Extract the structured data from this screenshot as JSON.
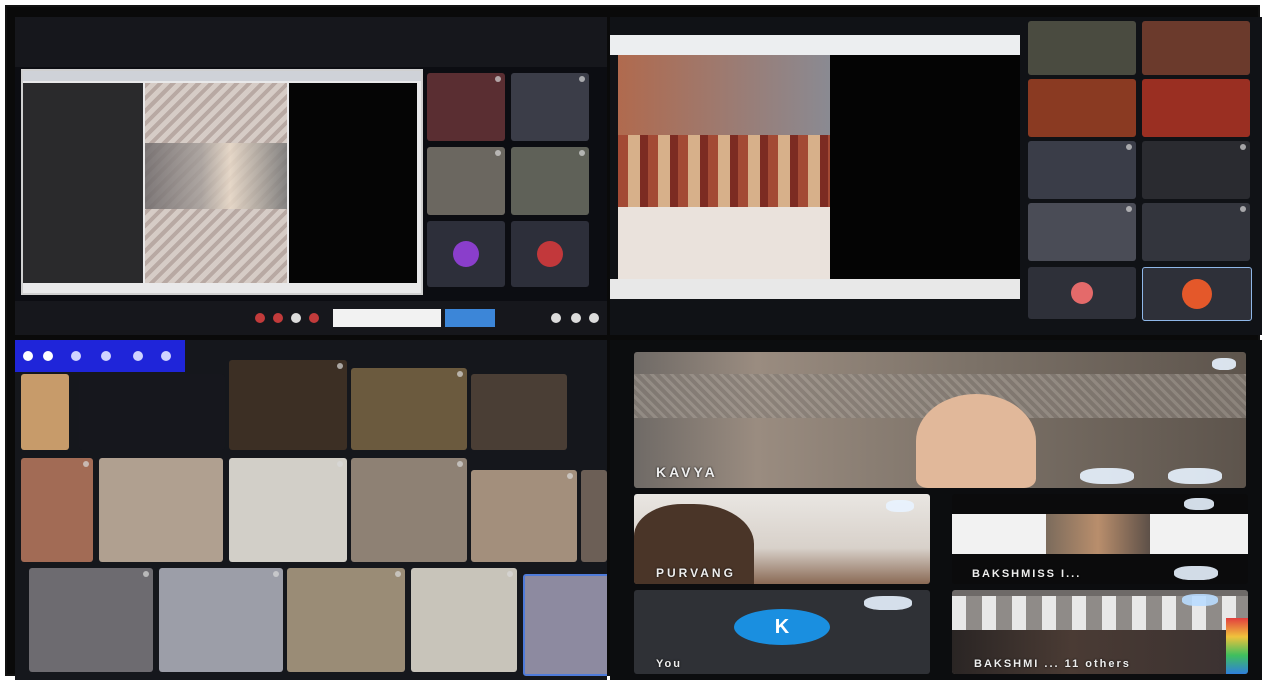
{
  "participants": {
    "bottom_right": {
      "main_tile": "KAVYA",
      "left_tile": "PURVANG",
      "right_tile": "BAKSHMISS I...",
      "self_avatar_letter": "K",
      "self_label": "You",
      "others_tile": "BAKSHMI ... 11 others"
    }
  },
  "colors": {
    "blue_toolbar": "#1f25d9",
    "avatar_blue": "#1a8fe0",
    "avatar_orange": "#e4582a",
    "avatar_purple": "#8a3ecb"
  }
}
